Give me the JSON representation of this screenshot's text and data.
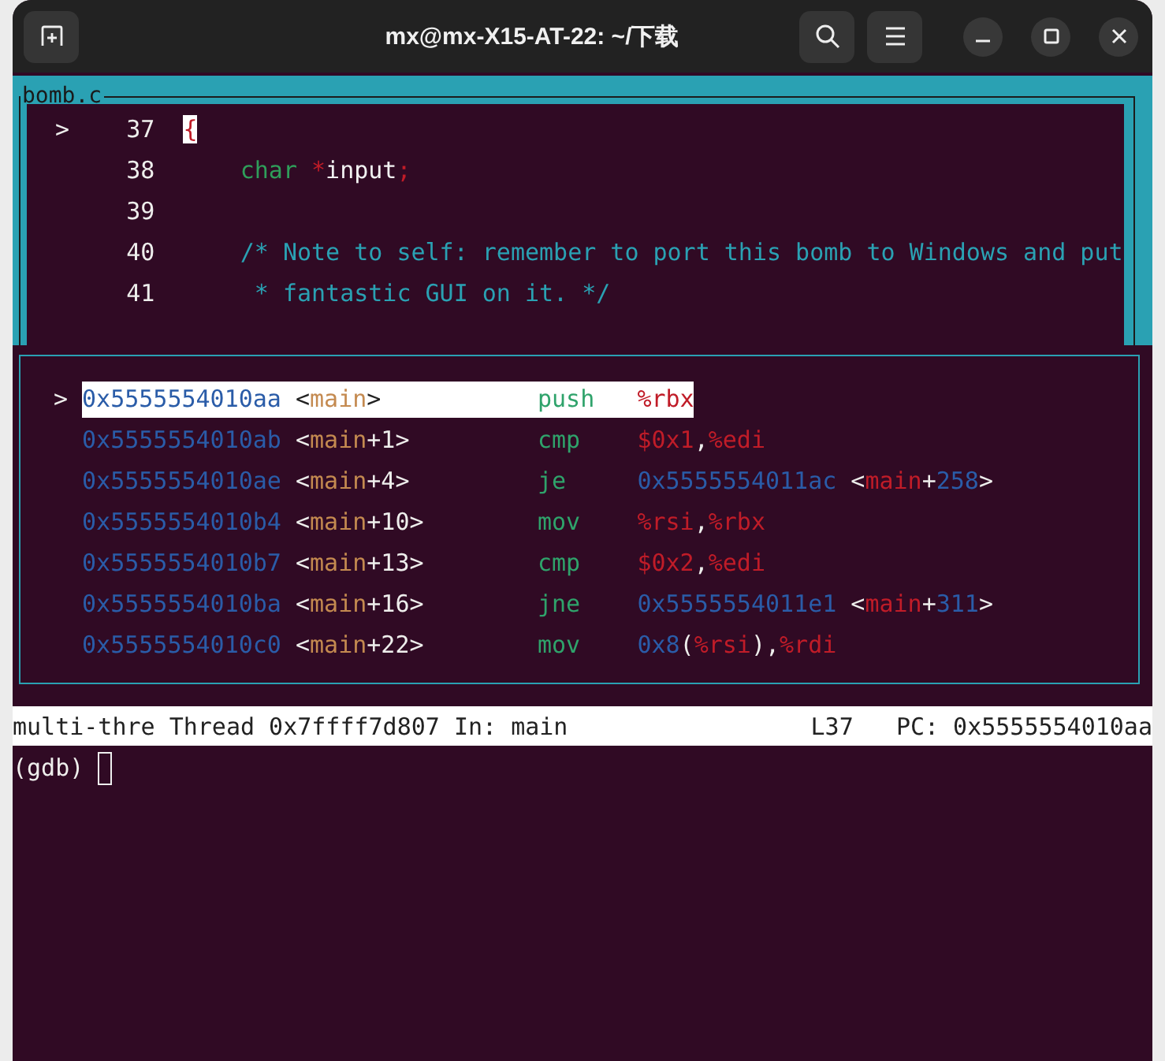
{
  "window": {
    "title": "mx@mx-X15-AT-22: ~/下载"
  },
  "source": {
    "file": "bomb.c",
    "lines": [
      {
        "marker": ">",
        "number": "37",
        "tokens": [
          {
            "kind": "punct",
            "text": "{",
            "cursor": true
          }
        ]
      },
      {
        "number": "38",
        "tokens": [
          {
            "kind": "keyword",
            "text": "    char",
            "cursor": false
          },
          {
            "kind": "op",
            "text": " *",
            "cursor": false
          },
          {
            "kind": "ident",
            "text": "input",
            "cursor": false
          },
          {
            "kind": "punct",
            "text": ";",
            "cursor": false
          }
        ]
      },
      {
        "number": "39"
      },
      {
        "number": "40",
        "tokens": [
          {
            "kind": "comment",
            "text": "    /* Note to self: remember to port this bomb to Windows and put",
            "cursor": false
          }
        ]
      },
      {
        "number": "41",
        "tokens": [
          {
            "kind": "comment",
            "text": "     * fantastic GUI on it. */",
            "cursor": false
          }
        ]
      }
    ]
  },
  "disassembly": {
    "rows": [
      {
        "selected": true,
        "marker": ">",
        "address": "0x5555554010aa",
        "symbol": [
          {
            "kind": "plain",
            "text": "<"
          },
          {
            "kind": "func",
            "text": "main"
          },
          {
            "kind": "plain",
            "text": ">"
          }
        ],
        "mnemonic": "push",
        "operands": [
          {
            "kind": "reg",
            "text": "%rbx"
          }
        ]
      },
      {
        "selected": false,
        "address": "0x5555554010ab",
        "symbol": [
          {
            "kind": "plain",
            "text": "<"
          },
          {
            "kind": "func",
            "text": "main"
          },
          {
            "kind": "plain",
            "text": "+1>"
          }
        ],
        "mnemonic": "cmp",
        "operands": [
          {
            "kind": "reg",
            "text": "$0x1"
          },
          {
            "kind": "plain",
            "text": ","
          },
          {
            "kind": "reg",
            "text": "%edi"
          }
        ]
      },
      {
        "selected": false,
        "address": "0x5555554010ae",
        "symbol": [
          {
            "kind": "plain",
            "text": "<"
          },
          {
            "kind": "func",
            "text": "main"
          },
          {
            "kind": "plain",
            "text": "+4>"
          }
        ],
        "mnemonic": "je",
        "operands": [
          {
            "kind": "num",
            "text": "0x5555554011ac"
          },
          {
            "kind": "plain",
            "text": " <"
          },
          {
            "kind": "reg",
            "text": "main"
          },
          {
            "kind": "plain",
            "text": "+"
          },
          {
            "kind": "num",
            "text": "258"
          },
          {
            "kind": "plain",
            "text": ">"
          }
        ]
      },
      {
        "selected": false,
        "address": "0x5555554010b4",
        "symbol": [
          {
            "kind": "plain",
            "text": "<"
          },
          {
            "kind": "func",
            "text": "main"
          },
          {
            "kind": "plain",
            "text": "+10>"
          }
        ],
        "mnemonic": "mov",
        "operands": [
          {
            "kind": "reg",
            "text": "%rsi"
          },
          {
            "kind": "plain",
            "text": ","
          },
          {
            "kind": "reg",
            "text": "%rbx"
          }
        ]
      },
      {
        "selected": false,
        "address": "0x5555554010b7",
        "symbol": [
          {
            "kind": "plain",
            "text": "<"
          },
          {
            "kind": "func",
            "text": "main"
          },
          {
            "kind": "plain",
            "text": "+13>"
          }
        ],
        "mnemonic": "cmp",
        "operands": [
          {
            "kind": "reg",
            "text": "$0x2"
          },
          {
            "kind": "plain",
            "text": ","
          },
          {
            "kind": "reg",
            "text": "%edi"
          }
        ]
      },
      {
        "selected": false,
        "address": "0x5555554010ba",
        "symbol": [
          {
            "kind": "plain",
            "text": "<"
          },
          {
            "kind": "func",
            "text": "main"
          },
          {
            "kind": "plain",
            "text": "+16>"
          }
        ],
        "mnemonic": "jne",
        "operands": [
          {
            "kind": "num",
            "text": "0x5555554011e1"
          },
          {
            "kind": "plain",
            "text": " <"
          },
          {
            "kind": "reg",
            "text": "main"
          },
          {
            "kind": "plain",
            "text": "+"
          },
          {
            "kind": "num",
            "text": "311"
          },
          {
            "kind": "plain",
            "text": ">"
          }
        ]
      },
      {
        "selected": false,
        "address": "0x5555554010c0",
        "symbol": [
          {
            "kind": "plain",
            "text": "<"
          },
          {
            "kind": "func",
            "text": "main"
          },
          {
            "kind": "plain",
            "text": "+22>"
          }
        ],
        "mnemonic": "mov",
        "operands": [
          {
            "kind": "num",
            "text": "0x8"
          },
          {
            "kind": "plain",
            "text": "("
          },
          {
            "kind": "reg",
            "text": "%rsi"
          },
          {
            "kind": "plain",
            "text": "),"
          },
          {
            "kind": "reg",
            "text": "%rdi"
          }
        ]
      }
    ]
  },
  "status_bar": {
    "left": "multi-thre Thread 0x7ffff7d807 In: main",
    "line": "L37",
    "pc": "PC: 0x5555554010aa"
  },
  "prompt": "(gdb)"
}
